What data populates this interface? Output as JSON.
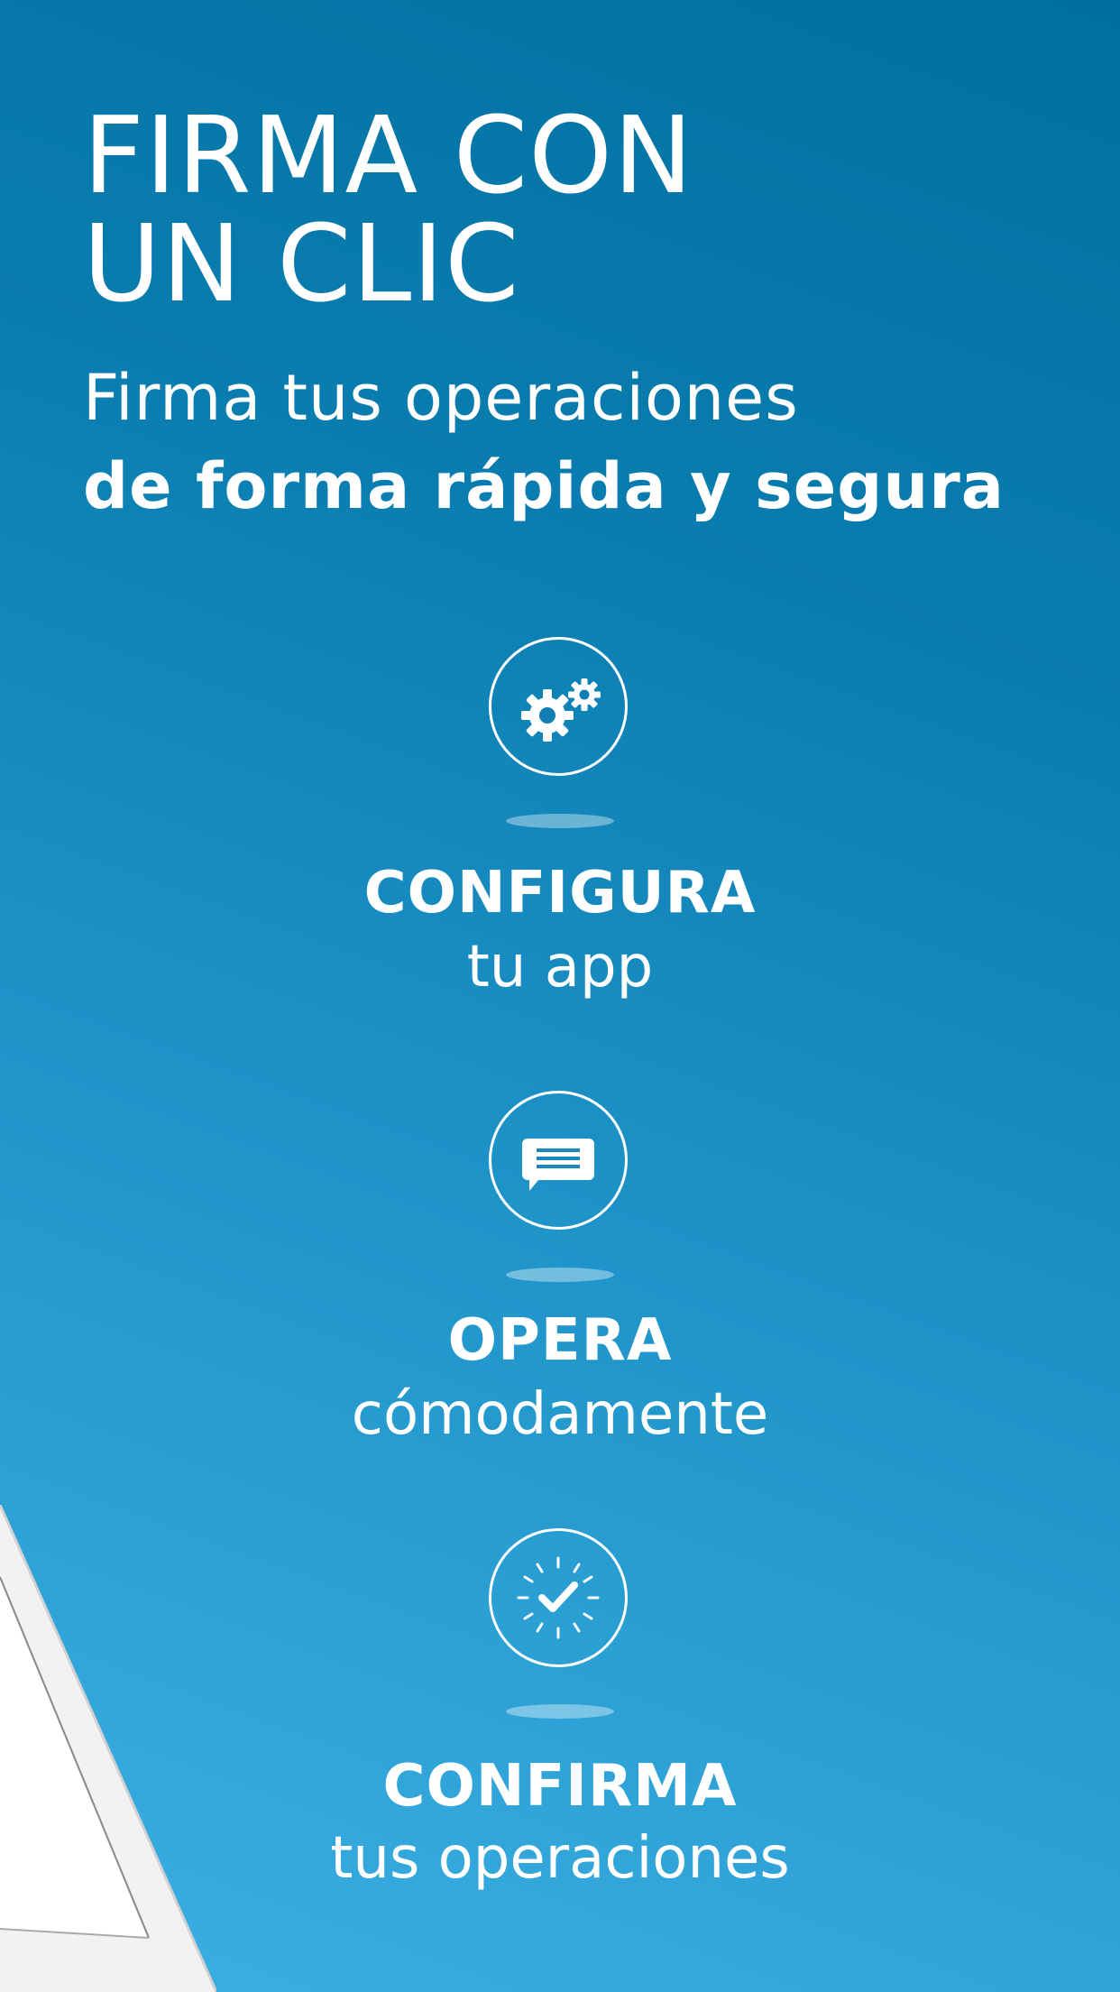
{
  "headline": {
    "line1": "FIRMA CON",
    "line2": "UN CLIC"
  },
  "subtitle": {
    "line1": "Firma tus operaciones",
    "line2": "de forma rápida y segura"
  },
  "steps": [
    {
      "icon": "gears-icon",
      "title": "CONFIGURA",
      "subtitle": "tu app"
    },
    {
      "icon": "chat-bubble-icon",
      "title": "OPERA",
      "subtitle": "cómodamente"
    },
    {
      "icon": "check-timer-icon",
      "title": "CONFIRMA",
      "subtitle": "tus operaciones"
    }
  ],
  "colors": {
    "background_top": "#00709f",
    "background_bottom": "#3cb0e4",
    "text": "#ffffff"
  }
}
